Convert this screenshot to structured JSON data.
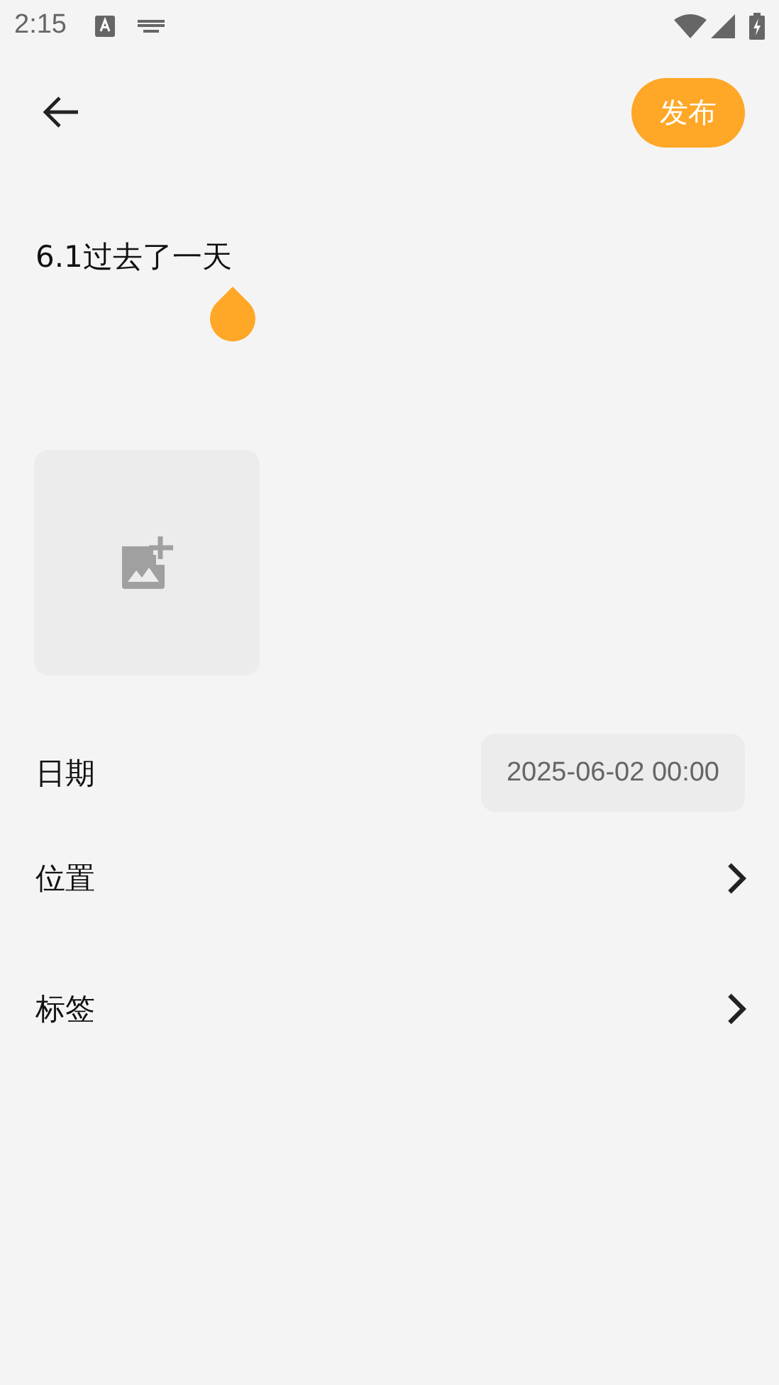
{
  "status_bar": {
    "time": "2:15"
  },
  "toolbar": {
    "publish_button": "发布"
  },
  "title_field": {
    "value": "6.1过去了一天"
  },
  "photo_slot": {
    "kind": "add-photo"
  },
  "rows": [
    {
      "kind": "value",
      "label": "日期",
      "value": "2025-06-02 00:00"
    },
    {
      "kind": "link",
      "label": "位置"
    },
    {
      "kind": "link",
      "label": "标签"
    }
  ]
}
